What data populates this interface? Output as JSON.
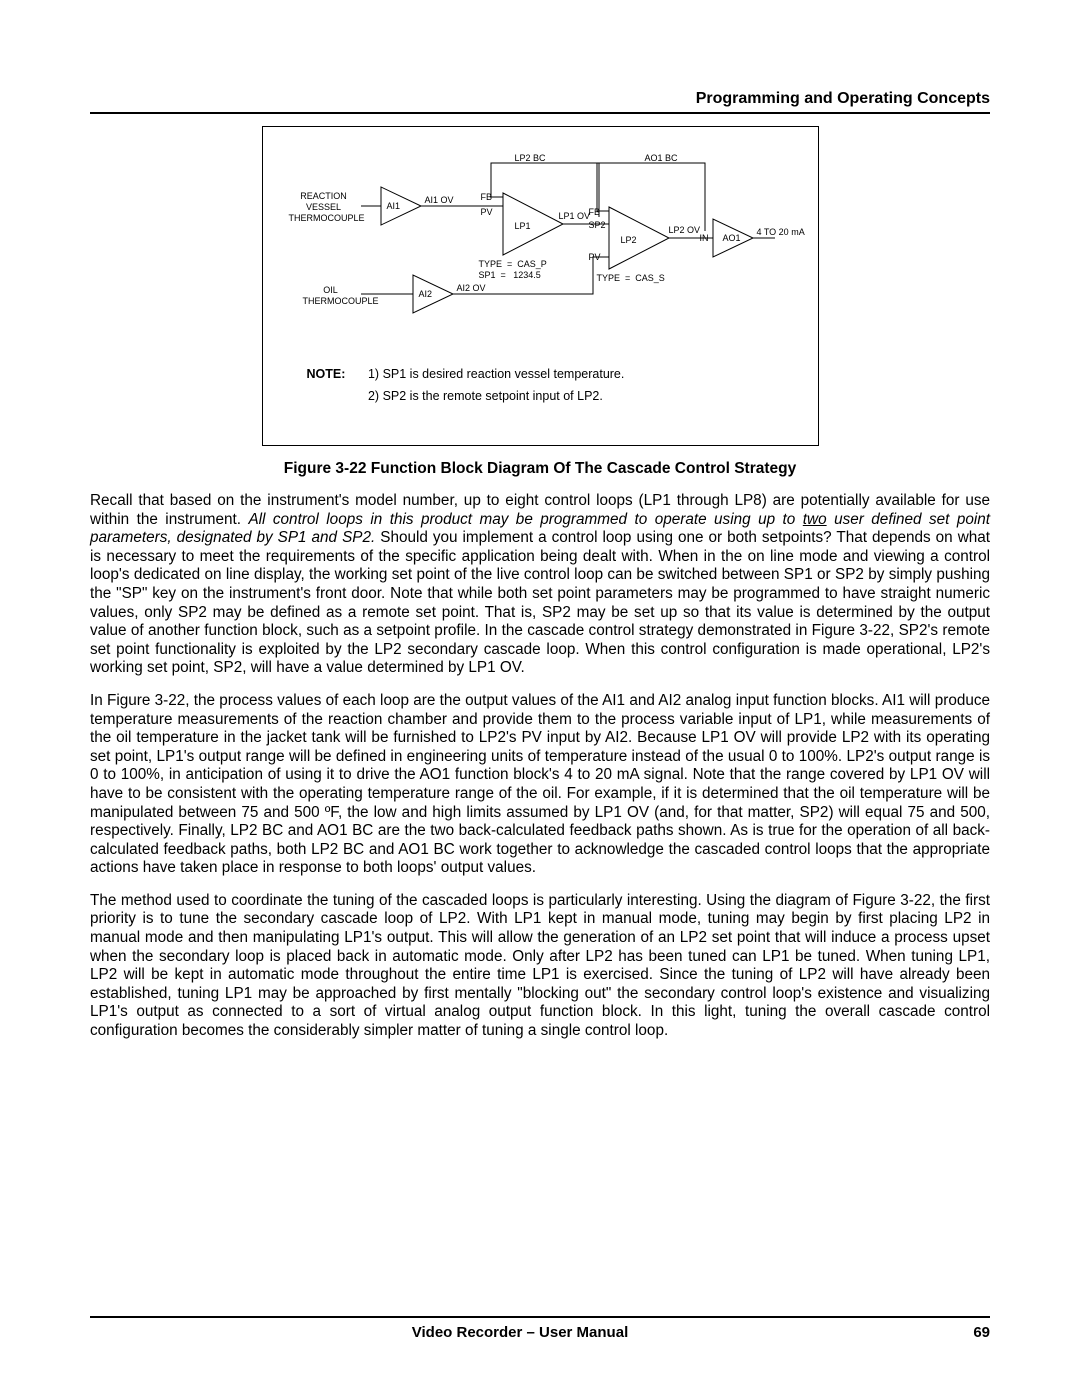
{
  "header": {
    "section": "Programming and Operating Concepts"
  },
  "figure": {
    "caption": "Figure 3-22  Function Block Diagram Of The Cascade Control Strategy",
    "labels": {
      "reaction_tc": "REACTION\nVESSEL\nTHERMOCOUPLE",
      "oil_tc": "OIL\nTHERMOCOUPLE",
      "ai1": "AI1",
      "ai2": "AI2",
      "ai1_ov": "AI1 OV",
      "ai2_ov": "AI2 OV",
      "lp1_blk": "LP1",
      "lp2_blk": "LP2",
      "ao1_blk": "AO1",
      "pv1": "PV",
      "pv2": "PV",
      "fb1": "FB",
      "fb2": "FB",
      "sp2": "SP2",
      "in": "IN",
      "lp1_ov": "LP1 OV",
      "lp2_ov": "LP2 OV",
      "lp2_bc": "LP2 BC",
      "ao1_bc": "AO1 BC",
      "type_cas_p": "TYPE  =  CAS_P\nSP1  =   1234.5",
      "type_cas_s": "TYPE  =  CAS_S",
      "output": "4 TO 20 mA"
    },
    "note": {
      "label": "NOTE:",
      "line1": "1)   SP1 is desired reaction vessel temperature.",
      "line2": "2)   SP2 is the remote setpoint input of LP2."
    }
  },
  "paragraphs": {
    "p1a": "Recall that based on the instrument's model number, up to eight control loops (LP1 through LP8) are potentially available for use within the instrument.  ",
    "p1b_italic_pre": "All control loops in this product may be programmed to operate using up to ",
    "p1b_two": "two",
    "p1b_italic_post": " user defined set point parameters, designated by SP1 and SP2.",
    "p1c": "  Should you implement a control loop using one or both setpoints?  That depends on what is necessary to meet the requirements of the specific application being dealt with.  When in the on line mode and viewing a control loop's dedicated on line display, the working set point of the live control loop can be switched between SP1 or SP2 by simply pushing the \"SP\" key on the instrument's front door.  Note that while both set point parameters may be programmed to have straight numeric values, only SP2 may be defined as a remote set point.  That is, SP2 may be set up so that its value is determined by the output value of another function block, such as a setpoint profile.  In the cascade control strategy demonstrated in Figure 3-22, SP2's remote set point functionality is exploited by the LP2 secondary cascade loop.  When this control configuration is made operational, LP2's working set point, SP2, will have a value determined by LP1 OV.",
    "p2": "In Figure 3-22, the process values of each loop are the output values of the AI1 and AI2 analog input function blocks.  AI1 will produce temperature measurements of the reaction chamber and provide them to the process variable input of LP1, while measurements of the oil temperature in the jacket tank will be furnished to LP2's PV input by AI2.  Because LP1 OV will provide LP2 with its operating set point, LP1's output range will be defined in engineering units of temperature instead of the usual 0 to 100%.  LP2's output range is 0 to 100%, in anticipation of using it to drive the AO1 function block's 4 to 20 mA signal.  Note that the range covered by LP1 OV will have to be consistent with the operating temperature range of the oil.  For example, if it is determined that the oil  temperature will be manipulated between 75 and 500 ºF, the low and high limits assumed by LP1 OV (and, for that matter, SP2) will equal 75 and 500, respectively.  Finally, LP2 BC and AO1 BC are the two back-calculated feedback paths shown.  As is true for the operation of all back-calculated feedback paths, both LP2 BC and AO1 BC work together to acknowledge the cascaded control loops that the appropriate actions have taken place in response to both loops' output values.",
    "p3": "The method used to coordinate the tuning of the cascaded loops is particularly interesting.  Using the diagram of Figure 3-22, the first priority is to tune the secondary cascade loop of LP2.  With LP1 kept in manual mode, tuning may begin by first placing LP2 in manual mode and then manipulating LP1's output.   This will allow the generation of an LP2 set point that will induce a process upset when the secondary loop is placed back in automatic mode.  Only after LP2 has been tuned can LP1 be tuned.  When tuning LP1, LP2 will be kept in automatic mode throughout the entire time LP1 is exercised.  Since the tuning of LP2 will have already been established, tuning LP1 may be approached by first mentally \"blocking out\" the secondary control loop's existence and visualizing LP1's output as connected to a sort of virtual analog output function block.  In this light, tuning the overall cascade control configuration becomes the considerably simpler matter of tuning a single control loop."
  },
  "footer": {
    "title": "Video Recorder – User Manual",
    "page": "69"
  }
}
